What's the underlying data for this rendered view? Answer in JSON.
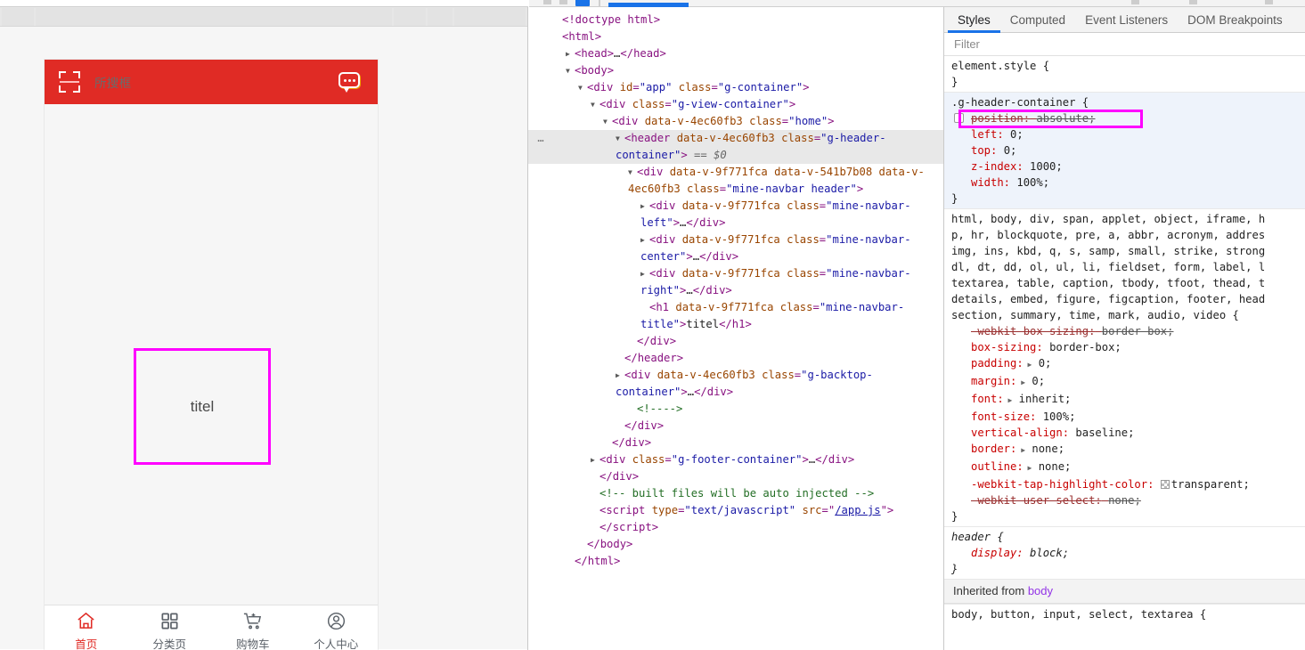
{
  "devtools": {
    "styles_tabs": [
      {
        "label": "Styles",
        "active": true
      },
      {
        "label": "Computed",
        "active": false
      },
      {
        "label": "Event Listeners",
        "active": false
      },
      {
        "label": "DOM Breakpoints",
        "active": false
      }
    ],
    "filter_placeholder": "Filter",
    "selected_marker": "== $0"
  },
  "mobile": {
    "header": {
      "scan_icon": "scan-icon",
      "search_text": "所搜框",
      "message_icon": "message-bubble-icon",
      "background_color": "#e02b25"
    },
    "content": {
      "highlight_box_text": "titel",
      "highlight_color": "#ff00ff"
    },
    "tabbar": [
      {
        "label": "首页",
        "icon": "home-icon",
        "active": true
      },
      {
        "label": "分类页",
        "icon": "grid-icon",
        "active": false
      },
      {
        "label": "购物车",
        "icon": "cart-icon",
        "active": false
      },
      {
        "label": "个人中心",
        "icon": "user-icon",
        "active": false
      }
    ]
  },
  "dom": {
    "lines": [
      {
        "indent": 0,
        "arrow": "",
        "gutter": "",
        "selected": false,
        "parts": [
          {
            "t": "punct",
            "v": "<!doctype html>"
          }
        ]
      },
      {
        "indent": 0,
        "arrow": "",
        "gutter": "",
        "selected": false,
        "parts": [
          {
            "t": "punct",
            "v": "<"
          },
          {
            "t": "tagname",
            "v": "html"
          },
          {
            "t": "punct",
            "v": ">"
          }
        ]
      },
      {
        "indent": 1,
        "arrow": "collapsed",
        "gutter": "",
        "selected": false,
        "parts": [
          {
            "t": "punct",
            "v": "<"
          },
          {
            "t": "tagname",
            "v": "head"
          },
          {
            "t": "punct",
            "v": ">"
          },
          {
            "t": "txtnode",
            "v": "…"
          },
          {
            "t": "punct",
            "v": "</"
          },
          {
            "t": "tagname",
            "v": "head"
          },
          {
            "t": "punct",
            "v": ">"
          }
        ]
      },
      {
        "indent": 1,
        "arrow": "open",
        "gutter": "",
        "selected": false,
        "parts": [
          {
            "t": "punct",
            "v": "<"
          },
          {
            "t": "tagname",
            "v": "body"
          },
          {
            "t": "punct",
            "v": ">"
          }
        ]
      },
      {
        "indent": 2,
        "arrow": "open",
        "gutter": "",
        "selected": false,
        "parts": [
          {
            "t": "punct",
            "v": "<"
          },
          {
            "t": "tagname",
            "v": "div"
          },
          {
            "t": "attr",
            "v": " id"
          },
          {
            "t": "punct",
            "v": "="
          },
          {
            "t": "val",
            "v": "\"app\""
          },
          {
            "t": "attr",
            "v": " class"
          },
          {
            "t": "punct",
            "v": "="
          },
          {
            "t": "val",
            "v": "\"g-container\""
          },
          {
            "t": "punct",
            "v": ">"
          }
        ]
      },
      {
        "indent": 3,
        "arrow": "open",
        "gutter": "",
        "selected": false,
        "parts": [
          {
            "t": "punct",
            "v": "<"
          },
          {
            "t": "tagname",
            "v": "div"
          },
          {
            "t": "attr",
            "v": " class"
          },
          {
            "t": "punct",
            "v": "="
          },
          {
            "t": "val",
            "v": "\"g-view-container\""
          },
          {
            "t": "punct",
            "v": ">"
          }
        ]
      },
      {
        "indent": 4,
        "arrow": "open",
        "gutter": "",
        "selected": false,
        "parts": [
          {
            "t": "punct",
            "v": "<"
          },
          {
            "t": "tagname",
            "v": "div"
          },
          {
            "t": "attr",
            "v": " data-v-4ec60fb3"
          },
          {
            "t": "attr",
            "v": " class"
          },
          {
            "t": "punct",
            "v": "="
          },
          {
            "t": "val",
            "v": "\"home\""
          },
          {
            "t": "punct",
            "v": ">"
          }
        ]
      },
      {
        "indent": 5,
        "arrow": "open",
        "gutter": "…",
        "selected": true,
        "parts": [
          {
            "t": "punct",
            "v": "<"
          },
          {
            "t": "tagname",
            "v": "header"
          },
          {
            "t": "attr",
            "v": " data-v-4ec60fb3"
          },
          {
            "t": "attr",
            "v": " class"
          },
          {
            "t": "punct",
            "v": "="
          },
          {
            "t": "val",
            "v": "\"g-header-container\""
          },
          {
            "t": "punct",
            "v": ">"
          },
          {
            "t": "eq0",
            "v": " == $0"
          }
        ]
      },
      {
        "indent": 6,
        "arrow": "open",
        "gutter": "",
        "selected": false,
        "parts": [
          {
            "t": "punct",
            "v": "<"
          },
          {
            "t": "tagname",
            "v": "div"
          },
          {
            "t": "attr",
            "v": " data-v-9f771fca"
          },
          {
            "t": "attr",
            "v": " data-v-541b7b08"
          },
          {
            "t": "attr",
            "v": " data-v-4ec60fb3"
          },
          {
            "t": "attr",
            "v": " class"
          },
          {
            "t": "punct",
            "v": "="
          },
          {
            "t": "val",
            "v": "\"mine-navbar header\""
          },
          {
            "t": "punct",
            "v": ">"
          }
        ]
      },
      {
        "indent": 7,
        "arrow": "collapsed",
        "gutter": "",
        "selected": false,
        "parts": [
          {
            "t": "punct",
            "v": "<"
          },
          {
            "t": "tagname",
            "v": "div"
          },
          {
            "t": "attr",
            "v": " data-v-9f771fca"
          },
          {
            "t": "attr",
            "v": " class"
          },
          {
            "t": "punct",
            "v": "="
          },
          {
            "t": "val",
            "v": "\"mine-navbar-left\""
          },
          {
            "t": "punct",
            "v": ">"
          },
          {
            "t": "txtnode",
            "v": "…"
          },
          {
            "t": "punct",
            "v": "</"
          },
          {
            "t": "tagname",
            "v": "div"
          },
          {
            "t": "punct",
            "v": ">"
          }
        ]
      },
      {
        "indent": 7,
        "arrow": "collapsed",
        "gutter": "",
        "selected": false,
        "parts": [
          {
            "t": "punct",
            "v": "<"
          },
          {
            "t": "tagname",
            "v": "div"
          },
          {
            "t": "attr",
            "v": " data-v-9f771fca"
          },
          {
            "t": "attr",
            "v": " class"
          },
          {
            "t": "punct",
            "v": "="
          },
          {
            "t": "val",
            "v": "\"mine-navbar-center\""
          },
          {
            "t": "punct",
            "v": ">"
          },
          {
            "t": "txtnode",
            "v": "…"
          },
          {
            "t": "punct",
            "v": "</"
          },
          {
            "t": "tagname",
            "v": "div"
          },
          {
            "t": "punct",
            "v": ">"
          }
        ]
      },
      {
        "indent": 7,
        "arrow": "collapsed",
        "gutter": "",
        "selected": false,
        "parts": [
          {
            "t": "punct",
            "v": "<"
          },
          {
            "t": "tagname",
            "v": "div"
          },
          {
            "t": "attr",
            "v": " data-v-9f771fca"
          },
          {
            "t": "attr",
            "v": " class"
          },
          {
            "t": "punct",
            "v": "="
          },
          {
            "t": "val",
            "v": "\"mine-navbar-right\""
          },
          {
            "t": "punct",
            "v": ">"
          },
          {
            "t": "txtnode",
            "v": "…"
          },
          {
            "t": "punct",
            "v": "</"
          },
          {
            "t": "tagname",
            "v": "div"
          },
          {
            "t": "punct",
            "v": ">"
          }
        ]
      },
      {
        "indent": 7,
        "arrow": "",
        "gutter": "",
        "selected": false,
        "parts": [
          {
            "t": "punct",
            "v": "<"
          },
          {
            "t": "tagname",
            "v": "h1"
          },
          {
            "t": "attr",
            "v": " data-v-9f771fca"
          },
          {
            "t": "attr",
            "v": " class"
          },
          {
            "t": "punct",
            "v": "="
          },
          {
            "t": "val",
            "v": "\"mine-navbar-title\""
          },
          {
            "t": "punct",
            "v": ">"
          },
          {
            "t": "txtnode",
            "v": "titel"
          },
          {
            "t": "punct",
            "v": "</"
          },
          {
            "t": "tagname",
            "v": "h1"
          },
          {
            "t": "punct",
            "v": ">"
          }
        ]
      },
      {
        "indent": 6,
        "arrow": "",
        "gutter": "",
        "selected": false,
        "parts": [
          {
            "t": "punct",
            "v": "</"
          },
          {
            "t": "tagname",
            "v": "div"
          },
          {
            "t": "punct",
            "v": ">"
          }
        ]
      },
      {
        "indent": 5,
        "arrow": "",
        "gutter": "",
        "selected": false,
        "parts": [
          {
            "t": "punct",
            "v": "</"
          },
          {
            "t": "tagname",
            "v": "header"
          },
          {
            "t": "punct",
            "v": ">"
          }
        ]
      },
      {
        "indent": 5,
        "arrow": "collapsed",
        "gutter": "",
        "selected": false,
        "parts": [
          {
            "t": "punct",
            "v": "<"
          },
          {
            "t": "tagname",
            "v": "div"
          },
          {
            "t": "attr",
            "v": " data-v-4ec60fb3"
          },
          {
            "t": "attr",
            "v": " class"
          },
          {
            "t": "punct",
            "v": "="
          },
          {
            "t": "val",
            "v": "\"g-backtop-container\""
          },
          {
            "t": "punct",
            "v": ">"
          },
          {
            "t": "txtnode",
            "v": "…"
          },
          {
            "t": "punct",
            "v": "</"
          },
          {
            "t": "tagname",
            "v": "div"
          },
          {
            "t": "punct",
            "v": ">"
          }
        ]
      },
      {
        "indent": 6,
        "arrow": "",
        "gutter": "",
        "selected": false,
        "parts": [
          {
            "t": "comment",
            "v": "<!---->"
          }
        ]
      },
      {
        "indent": 5,
        "arrow": "",
        "gutter": "",
        "selected": false,
        "parts": [
          {
            "t": "punct",
            "v": "</"
          },
          {
            "t": "tagname",
            "v": "div"
          },
          {
            "t": "punct",
            "v": ">"
          }
        ]
      },
      {
        "indent": 4,
        "arrow": "",
        "gutter": "",
        "selected": false,
        "parts": [
          {
            "t": "punct",
            "v": "</"
          },
          {
            "t": "tagname",
            "v": "div"
          },
          {
            "t": "punct",
            "v": ">"
          }
        ]
      },
      {
        "indent": 3,
        "arrow": "collapsed",
        "gutter": "",
        "selected": false,
        "parts": [
          {
            "t": "punct",
            "v": "<"
          },
          {
            "t": "tagname",
            "v": "div"
          },
          {
            "t": "attr",
            "v": " class"
          },
          {
            "t": "punct",
            "v": "="
          },
          {
            "t": "val",
            "v": "\"g-footer-container\""
          },
          {
            "t": "punct",
            "v": ">"
          },
          {
            "t": "txtnode",
            "v": "…"
          },
          {
            "t": "punct",
            "v": "</"
          },
          {
            "t": "tagname",
            "v": "div"
          },
          {
            "t": "punct",
            "v": ">"
          }
        ]
      },
      {
        "indent": 3,
        "arrow": "",
        "gutter": "",
        "selected": false,
        "parts": [
          {
            "t": "punct",
            "v": "</"
          },
          {
            "t": "tagname",
            "v": "div"
          },
          {
            "t": "punct",
            "v": ">"
          }
        ]
      },
      {
        "indent": 3,
        "arrow": "",
        "gutter": "",
        "selected": false,
        "parts": [
          {
            "t": "comment",
            "v": "<!-- built files will be auto injected -->"
          }
        ]
      },
      {
        "indent": 3,
        "arrow": "",
        "gutter": "",
        "selected": false,
        "parts": [
          {
            "t": "punct",
            "v": "<"
          },
          {
            "t": "tagname",
            "v": "script"
          },
          {
            "t": "attr",
            "v": " type"
          },
          {
            "t": "punct",
            "v": "="
          },
          {
            "t": "val",
            "v": "\"text/javascript\""
          },
          {
            "t": "attr",
            "v": " src"
          },
          {
            "t": "punct",
            "v": "=\""
          },
          {
            "t": "lnk",
            "v": "/app.js"
          },
          {
            "t": "punct",
            "v": "\">"
          }
        ]
      },
      {
        "indent": 3,
        "arrow": "",
        "gutter": "",
        "selected": false,
        "parts": [
          {
            "t": "punct",
            "v": "</"
          },
          {
            "t": "tagname",
            "v": "script"
          },
          {
            "t": "punct",
            "v": ">"
          }
        ]
      },
      {
        "indent": 2,
        "arrow": "",
        "gutter": "",
        "selected": false,
        "parts": [
          {
            "t": "punct",
            "v": "</"
          },
          {
            "t": "tagname",
            "v": "body"
          },
          {
            "t": "punct",
            "v": ">"
          }
        ]
      },
      {
        "indent": 1,
        "arrow": "",
        "gutter": "",
        "selected": false,
        "parts": [
          {
            "t": "punct",
            "v": "</"
          },
          {
            "t": "tagname",
            "v": "html"
          },
          {
            "t": "punct",
            "v": ">"
          }
        ]
      }
    ]
  },
  "styles": {
    "rules": [
      {
        "id": "element-style",
        "selector": "element.style {",
        "close": "}",
        "highlighted": false,
        "italic": false,
        "props": []
      },
      {
        "id": "g-header-container",
        "selector": ".g-header-container {",
        "close": "}",
        "highlighted": true,
        "italic": false,
        "props": [
          {
            "name": "position",
            "value": "absolute;",
            "disabled": true,
            "checkbox": true,
            "outlined": true
          },
          {
            "name": "left",
            "value": "0;",
            "disabled": false
          },
          {
            "name": "top",
            "value": "0;",
            "disabled": false
          },
          {
            "name": "z-index",
            "value": "1000;",
            "disabled": false
          },
          {
            "name": "width",
            "value": "100%;",
            "disabled": false
          }
        ]
      },
      {
        "id": "css-reset",
        "selector": "html, body, div, span, applet, object, iframe, h\np, hr, blockquote, pre, a, abbr, acronym, addres\nimg, ins, kbd, q, s, samp, small, strike, strong\ndl, dt, dd, ol, ul, li, fieldset, form, label, l\ntextarea, table, caption, tbody, tfoot, thead, t\ndetails, embed, figure, figcaption, footer, head\nsection, summary, time, mark, audio, video {",
        "close": "}",
        "highlighted": false,
        "italic": false,
        "props": [
          {
            "name": "-webkit-box-sizing",
            "value": "border-box;",
            "disabled": true
          },
          {
            "name": "box-sizing",
            "value": "border-box;",
            "disabled": false
          },
          {
            "name": "padding",
            "value": "0;",
            "disabled": false,
            "expandable": true
          },
          {
            "name": "margin",
            "value": "0;",
            "disabled": false,
            "expandable": true
          },
          {
            "name": "font",
            "value": "inherit;",
            "disabled": false,
            "expandable": true
          },
          {
            "name": "font-size",
            "value": "100%;",
            "disabled": false
          },
          {
            "name": "vertical-align",
            "value": "baseline;",
            "disabled": false
          },
          {
            "name": "border",
            "value": "none;",
            "disabled": false,
            "expandable": true
          },
          {
            "name": "outline",
            "value": "none;",
            "disabled": false,
            "expandable": true
          },
          {
            "name": "-webkit-tap-highlight-color",
            "value": "transparent;",
            "disabled": false,
            "swatch": true
          },
          {
            "name": "-webkit-user-select",
            "value": "none;",
            "disabled": true
          }
        ]
      },
      {
        "id": "header-ua",
        "selector": "header {",
        "close": "}",
        "highlighted": false,
        "italic": true,
        "props": [
          {
            "name": "display",
            "value": "block;",
            "disabled": false
          }
        ]
      }
    ],
    "inherited_label": "Inherited from",
    "inherited_source": "body",
    "inherited_rule_selector": "body, button, input, select, textarea {"
  }
}
